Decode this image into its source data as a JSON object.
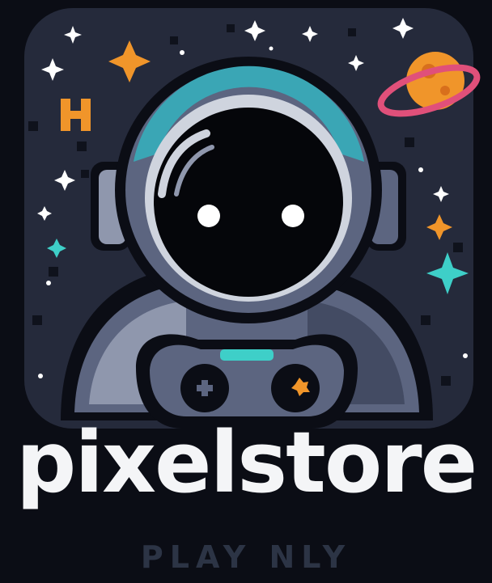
{
  "logo": {
    "name": "pixelstore",
    "tagline": "PLAY NLY",
    "icons": [
      "astronaut-icon",
      "game-controller-icon",
      "planet-icon",
      "sparkle-icon",
      "star-icon",
      "pixel-h-icon"
    ]
  },
  "colors": {
    "background": "#0b0d15",
    "panel": "#252a3b",
    "helmet_rim": "#3aa6b5",
    "visor": "#05060a",
    "suit": "#5c6580",
    "accent_orange": "#f0952a",
    "accent_pink": "#e0507a",
    "accent_teal": "#3ecfc8",
    "title_text": "#f4f5f7",
    "tagline_text": "#2c3445"
  }
}
